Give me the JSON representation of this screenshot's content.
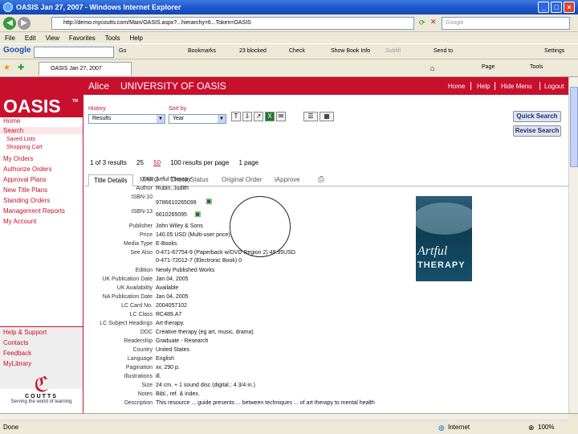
{
  "window": {
    "title": "OASIS Jan 27, 2007 - Windows Internet Explorer",
    "url": "http://demo.mycoutts.com/Main/OASIS.aspx?...hierarchy=6...Token=OASIS",
    "search_placeholder": "Google"
  },
  "menu": [
    "File",
    "Edit",
    "View",
    "Favorites",
    "Tools",
    "Help"
  ],
  "google_toolbar": {
    "logo": "Google",
    "go": "Go",
    "bookmarks": "Bookmarks",
    "blocked": "23 blocked",
    "check": "Check",
    "show_book_info": "Show Book Info",
    "subfill": "Subfill",
    "send_to": "Send to",
    "settings": "Settings"
  },
  "ie_tab": {
    "title": "OASIS Jan 27, 2007",
    "page": "Page",
    "tools": "Tools"
  },
  "header": {
    "user": "Alice",
    "org": "UNIVERSITY OF OASIS",
    "links": [
      "Home",
      "Help",
      "Hide Menu",
      "Logout"
    ]
  },
  "logo": {
    "text": "OASIS",
    "tm": "TM"
  },
  "nav": {
    "home": "Home",
    "search": "Search",
    "saved_lists": "Saved Lists",
    "shopping_cart": "Shopping Cart",
    "my_orders": "My Orders",
    "authorize_orders": "Authorize Orders",
    "approval_plans": "Approval Plans",
    "new_title_plans": "New Title Plans",
    "standing_orders": "Standing Orders",
    "management_reports": "Management Reports",
    "my_account": "My Account",
    "help_support": "Help & Support",
    "contacts": "Contacts",
    "feedback": "Feedback",
    "mylibrary": "MyLibrary"
  },
  "coutts": {
    "name": "COUTTS",
    "tagline": "Serving the world of learning"
  },
  "controls": {
    "history_label": "History",
    "history_value": "Results",
    "sortby_label": "Sort by",
    "sortby_value": "Year",
    "quick_search": "Quick Search",
    "revise_search": "Revise Search"
  },
  "results": {
    "count": "1 of 3 results",
    "per_page_25": "25",
    "per_page_50": "50",
    "per_page_100": "100 results per page",
    "pages": "1 page"
  },
  "tabs": [
    "Title Details",
    "MARC",
    "Check Status",
    "Original Order",
    "iApprove"
  ],
  "details": {
    "title_label": "Title",
    "title": "Artful Therapy",
    "author_label": "Author",
    "author": "Rubin, Judith",
    "isbn10_label": "ISBN-10",
    "isbn10": "9786610265099",
    "isbn13_label": "ISBN-13",
    "isbn13": "6610265095",
    "publisher_label": "Publisher",
    "publisher": "John Wiley & Sons",
    "price_label": "Price",
    "price": "140.05 USD (Multi-user price)",
    "format_label": "Media Type",
    "format": "E-Books",
    "see_also_label": "See Also",
    "see_also_1": "0-471-67754-9 (Paperback w/DVD Region 2) 49.95USD",
    "see_also_2": "0-471-72012-7 (Electronic Book) 0",
    "edition_label": "Edition",
    "edition": "Newly Published Works",
    "uk_pub_label": "UK Publication Date",
    "uk_pub": "Jan 04, 2005",
    "uk_avail_label": "UK Availability",
    "uk_avail": "Available",
    "na_pub_label": "NA Publication Date",
    "na_pub": "Jan 04, 2005",
    "lc_card_label": "LC Card No.",
    "lc_card": "2004057102",
    "lc_class_label": "LC Class",
    "lc_class": "RC489.A7",
    "lc_subject_label": "LC Subject Headings",
    "lc_subject": "Art therapy.",
    "ddc_label": "DDC",
    "ddc": "Creative therapy (eg art, music, drama)",
    "readership_label": "Readership",
    "readership": "Graduate - Research",
    "country_label": "Country",
    "country": "United States",
    "language_label": "Language",
    "language": "English",
    "pagination_label": "Pagination",
    "pagination": "xv, 290 p.",
    "illustrations_label": "Illustrations",
    "illustrations": "ill.",
    "size_label": "Size",
    "size": "24 cm. + 1 sound disc (digital ; 4 3/4 in.)",
    "notes_label": "Notes",
    "notes": "Bibl., ref. & index.",
    "description_label": "Description",
    "description": "This resource ... guide presents ... between techniques ... of art therapy to mental health"
  },
  "cover": {
    "line1": "Artful",
    "line2": "THERAPY"
  },
  "status": {
    "left": "Done",
    "zone": "Internet",
    "zoom": "100%"
  },
  "colors": {
    "brand": "#c8102e",
    "xp_blue": "#1b53c8"
  }
}
